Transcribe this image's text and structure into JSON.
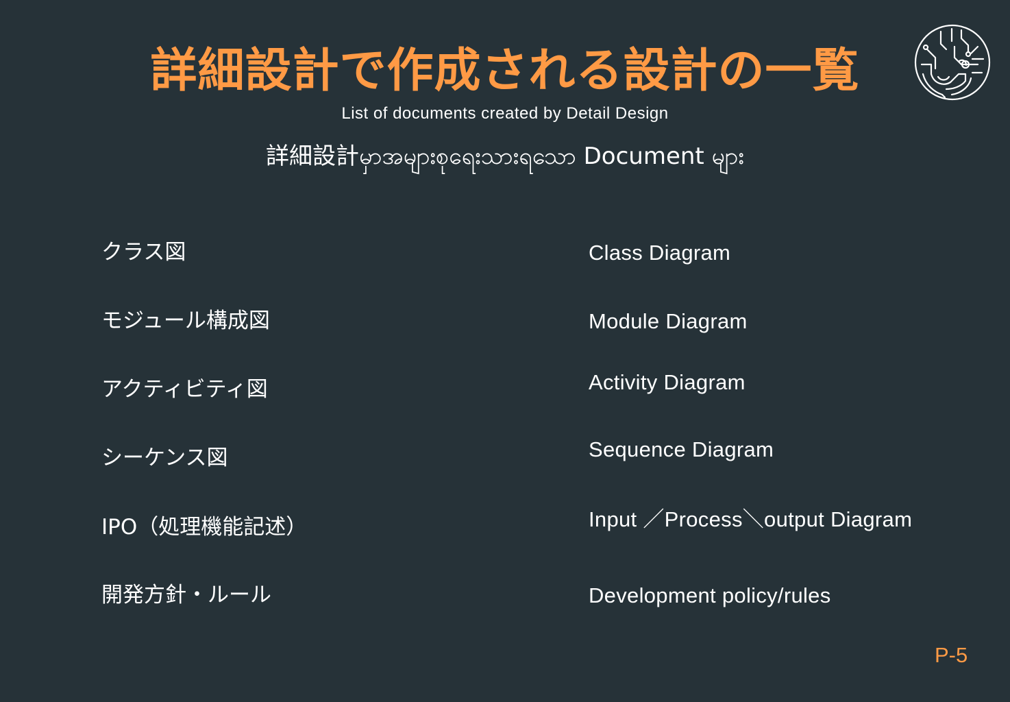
{
  "title": "詳細設計で作成される設計の一覧",
  "subtitle_en": "List of documents created by Detail Design",
  "subtitle_my": "詳細設計မှာအများစုရေးသားရသော Document များ",
  "logo_icon": "circuit-tree-logo-icon",
  "accent_color": "#ff9a45",
  "background_color": "#263238",
  "rows": [
    {
      "jp": "クラス図",
      "en": "Class Diagram"
    },
    {
      "jp": "モジュール構成図",
      "en": "Module Diagram"
    },
    {
      "jp": "アクティビティ図",
      "en": "Activity Diagram"
    },
    {
      "jp": "シーケンス図",
      "en": "Sequence Diagram"
    },
    {
      "jp": "IPO（処理機能記述）",
      "en": "Input ／Process＼output Diagram"
    },
    {
      "jp": "開発方針・ルール",
      "en": "Development policy/rules"
    }
  ],
  "page_number": "P-5"
}
